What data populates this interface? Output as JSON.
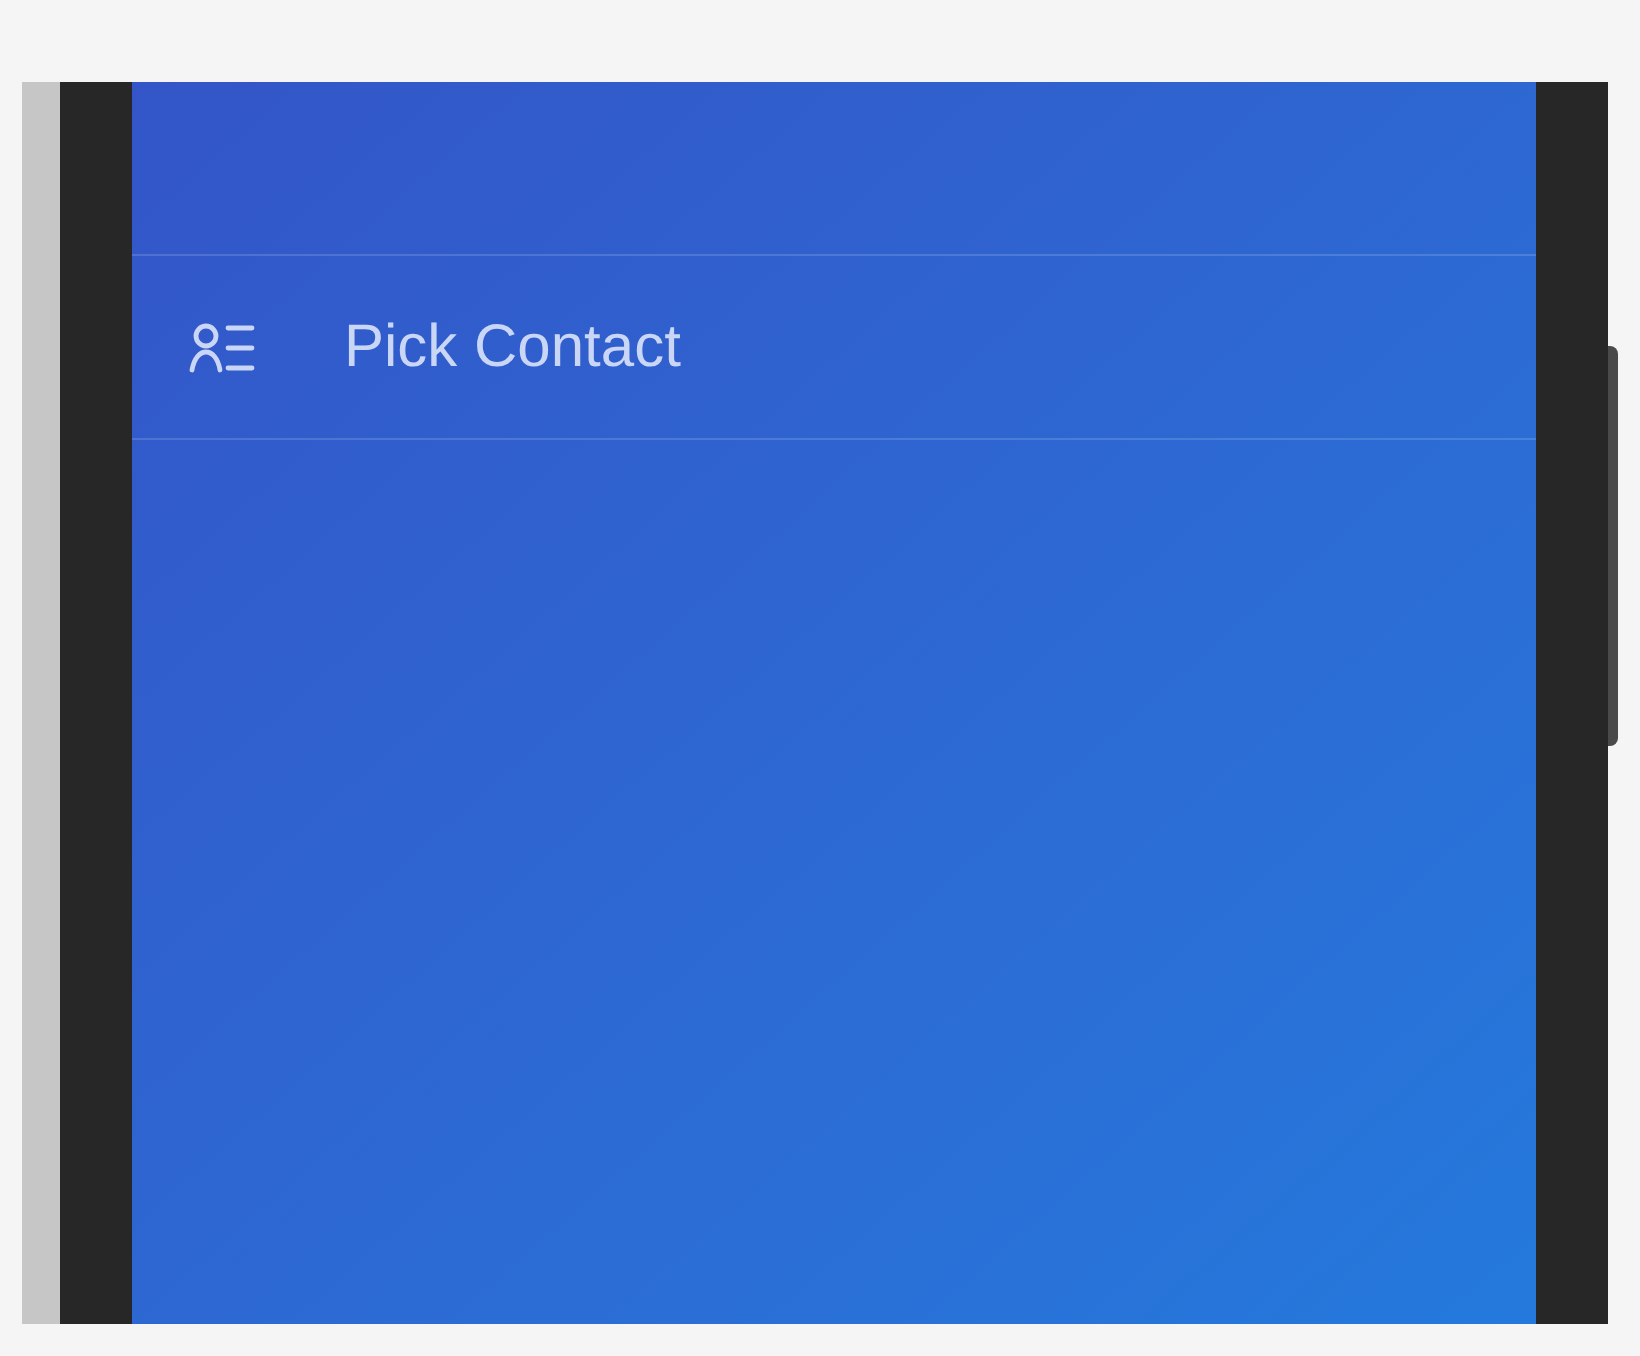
{
  "menu": {
    "items": [
      {
        "label": "Pick Contact"
      }
    ]
  }
}
